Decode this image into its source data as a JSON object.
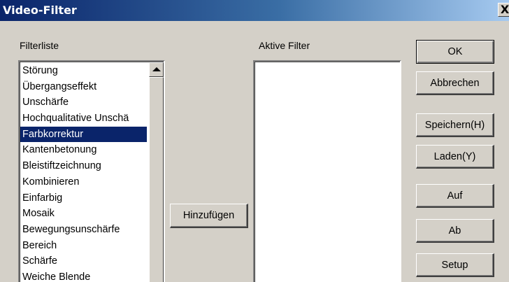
{
  "window": {
    "title": "Video-Filter",
    "close_glyph": "X"
  },
  "filter_list": {
    "label": "Filterliste",
    "selected_index": 4,
    "items": [
      "Störung",
      "Übergangseffekt",
      "Unschärfe",
      "Hochqualitative Unschä",
      "Farbkorrektur",
      "Kantenbetonung",
      "Bleistiftzeichnung",
      "Kombinieren",
      "Einfarbig",
      "Mosaik",
      "Bewegungsunschärfe",
      "Bereich",
      "Schärfe",
      "Weiche Blende"
    ]
  },
  "active_filters": {
    "label": "Aktive Filter",
    "items": []
  },
  "buttons": {
    "add": "Hinzufügen",
    "ok": "OK",
    "cancel": "Abbrechen",
    "save": "Speichern(H)",
    "load": "Laden(Y)",
    "up": "Auf",
    "down": "Ab",
    "setup": "Setup"
  },
  "colors": {
    "selection": "#0a246a",
    "dialog_face": "#d4d0c8"
  }
}
